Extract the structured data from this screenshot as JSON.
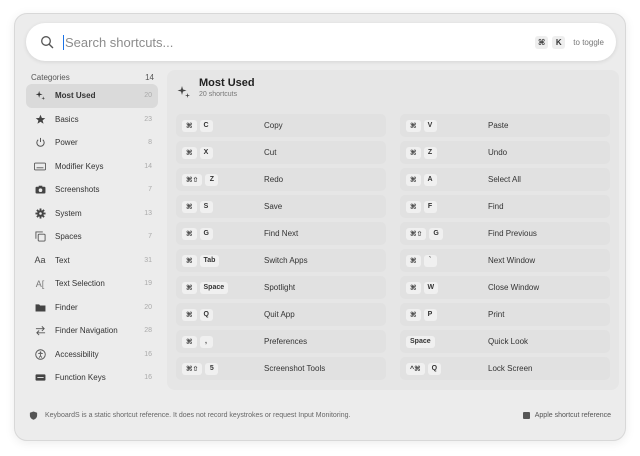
{
  "search": {
    "placeholder": "Search shortcuts...",
    "toggle_keys": [
      "⌘",
      "K"
    ],
    "toggle_label": "to toggle"
  },
  "sidebar": {
    "heading": "Categories",
    "total": "14",
    "items": [
      {
        "label": "Most Used",
        "count": "20",
        "icon": "sparkle-icon",
        "active": true
      },
      {
        "label": "Basics",
        "count": "23",
        "icon": "star-icon"
      },
      {
        "label": "Power",
        "count": "8",
        "icon": "power-icon"
      },
      {
        "label": "Modifier Keys",
        "count": "14",
        "icon": "keyboard-icon"
      },
      {
        "label": "Screenshots",
        "count": "7",
        "icon": "camera-icon"
      },
      {
        "label": "System",
        "count": "13",
        "icon": "gear-icon"
      },
      {
        "label": "Spaces",
        "count": "7",
        "icon": "spaces-icon"
      },
      {
        "label": "Text",
        "count": "31",
        "icon": "text-icon"
      },
      {
        "label": "Text Selection",
        "count": "19",
        "icon": "text-cursor-icon"
      },
      {
        "label": "Finder",
        "count": "20",
        "icon": "folder-icon"
      },
      {
        "label": "Finder Navigation",
        "count": "28",
        "icon": "arrows-icon"
      },
      {
        "label": "Accessibility",
        "count": "16",
        "icon": "accessibility-icon"
      },
      {
        "label": "Function Keys",
        "count": "16",
        "icon": "function-keys-icon"
      }
    ]
  },
  "main": {
    "title": "Most Used",
    "subtitle": "20 shortcuts",
    "shortcuts": [
      {
        "keys": [
          "⌘",
          "C"
        ],
        "label": "Copy"
      },
      {
        "keys": [
          "⌘",
          "V"
        ],
        "label": "Paste"
      },
      {
        "keys": [
          "⌘",
          "X"
        ],
        "label": "Cut"
      },
      {
        "keys": [
          "⌘",
          "Z"
        ],
        "label": "Undo"
      },
      {
        "keys": [
          "⌘⇧",
          "Z"
        ],
        "label": "Redo"
      },
      {
        "keys": [
          "⌘",
          "A"
        ],
        "label": "Select All"
      },
      {
        "keys": [
          "⌘",
          "S"
        ],
        "label": "Save"
      },
      {
        "keys": [
          "⌘",
          "F"
        ],
        "label": "Find"
      },
      {
        "keys": [
          "⌘",
          "G"
        ],
        "label": "Find Next"
      },
      {
        "keys": [
          "⌘⇧",
          "G"
        ],
        "label": "Find Previous"
      },
      {
        "keys": [
          "⌘",
          "Tab"
        ],
        "label": "Switch Apps"
      },
      {
        "keys": [
          "⌘",
          "`"
        ],
        "label": "Next Window"
      },
      {
        "keys": [
          "⌘",
          "Space"
        ],
        "label": "Spotlight"
      },
      {
        "keys": [
          "⌘",
          "W"
        ],
        "label": "Close Window"
      },
      {
        "keys": [
          "⌘",
          "Q"
        ],
        "label": "Quit App"
      },
      {
        "keys": [
          "⌘",
          "P"
        ],
        "label": "Print"
      },
      {
        "keys": [
          "⌘",
          ","
        ],
        "label": "Preferences"
      },
      {
        "keys": [
          "Space"
        ],
        "label": "Quick Look"
      },
      {
        "keys": [
          "⌘⇧",
          "5"
        ],
        "label": "Screenshot Tools"
      },
      {
        "keys": [
          "^⌘",
          "Q"
        ],
        "label": "Lock Screen"
      }
    ]
  },
  "footer": {
    "note": "KeyboardS is a static shortcut reference. It does not record keystrokes or request Input Monitoring.",
    "link": "Apple shortcut reference"
  }
}
